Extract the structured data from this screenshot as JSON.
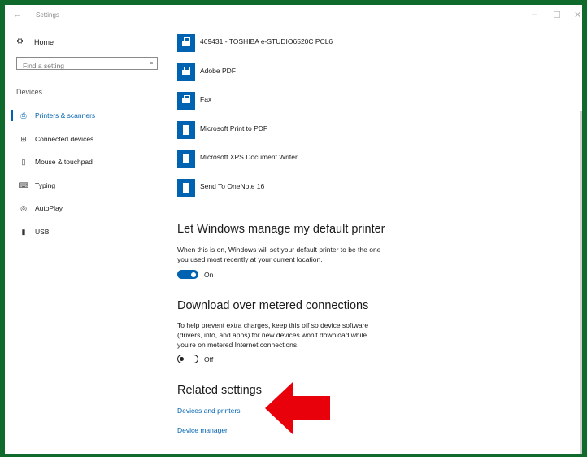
{
  "window": {
    "back_glyph": "←",
    "title": "Settings",
    "minimize": "–",
    "maximize": "☐",
    "close": "✕"
  },
  "sidebar": {
    "home_icon": "gear-icon",
    "home_label": "Home",
    "search_placeholder": "Find a setting",
    "section": "Devices",
    "items": [
      {
        "label": "Printers & scanners",
        "icon": "printer-icon",
        "active": true
      },
      {
        "label": "Connected devices",
        "icon": "connected-devices-icon",
        "active": false
      },
      {
        "label": "Mouse & touchpad",
        "icon": "mouse-icon",
        "active": false
      },
      {
        "label": "Typing",
        "icon": "keyboard-icon",
        "active": false
      },
      {
        "label": "AutoPlay",
        "icon": "autoplay-icon",
        "active": false
      },
      {
        "label": "USB",
        "icon": "usb-icon",
        "active": false
      }
    ]
  },
  "printers": [
    {
      "name": "469431 - TOSHIBA e-STUDIO6520C PCL6",
      "icon": "printer-icon"
    },
    {
      "name": "Adobe PDF",
      "icon": "printer-icon"
    },
    {
      "name": "Fax",
      "icon": "printer-icon"
    },
    {
      "name": "Microsoft Print to PDF",
      "icon": "document-printer-icon"
    },
    {
      "name": "Microsoft XPS Document Writer",
      "icon": "document-printer-icon"
    },
    {
      "name": "Send To OneNote 16",
      "icon": "document-printer-icon"
    }
  ],
  "default_printer": {
    "heading": "Let Windows manage my default printer",
    "description": "When this is on, Windows will set your default printer to be the one you used most recently at your current location.",
    "toggle_state": "On"
  },
  "metered": {
    "heading": "Download over metered connections",
    "description": "To help prevent extra charges, keep this off so device software (drivers, info, and apps) for new devices won't download while you're on metered Internet connections.",
    "toggle_state": "Off"
  },
  "related": {
    "heading": "Related settings",
    "links": [
      "Devices and printers",
      "Device manager"
    ]
  },
  "annotation": {
    "arrow_color": "#e8000b"
  },
  "colors": {
    "accent": "#0063b1",
    "frame": "#0f6a2c"
  }
}
